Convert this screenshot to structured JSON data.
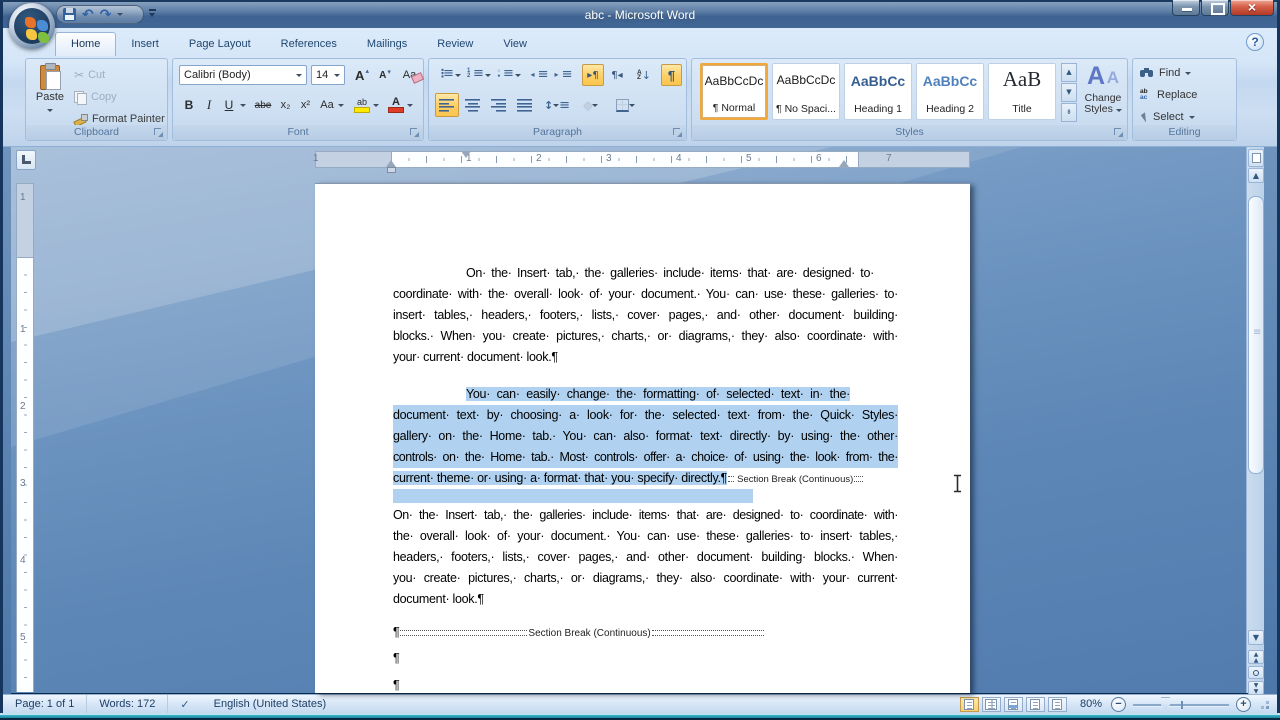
{
  "window": {
    "title": "abc  -  Microsoft Word"
  },
  "tabs": {
    "items": [
      "Home",
      "Insert",
      "Page Layout",
      "References",
      "Mailings",
      "Review",
      "View"
    ],
    "active": "Home"
  },
  "ribbon": {
    "clipboard": {
      "label": "Clipboard",
      "paste": "Paste",
      "cut": "Cut",
      "copy": "Copy",
      "format_painter": "Format Painter"
    },
    "font": {
      "label": "Font",
      "name": "Calibri (Body)",
      "size": "14"
    },
    "paragraph": {
      "label": "Paragraph"
    },
    "styles": {
      "label": "Styles",
      "change": "Change Styles",
      "items": [
        {
          "sample": "AaBbCcDc",
          "name": "¶ Normal"
        },
        {
          "sample": "AaBbCcDc",
          "name": "¶ No Spaci..."
        },
        {
          "sample": "AaBbCc",
          "name": "Heading 1"
        },
        {
          "sample": "AaBbCc",
          "name": "Heading 2"
        },
        {
          "sample": "AaB",
          "name": "Title"
        }
      ]
    },
    "editing": {
      "label": "Editing",
      "find": "Find",
      "replace": "Replace",
      "select": "Select"
    }
  },
  "ruler": {
    "h_margin": "1",
    "h": [
      "1",
      "2",
      "3",
      "4",
      "5",
      "6"
    ],
    "h_right": "7",
    "v_margin": "1",
    "v": [
      "1",
      "2",
      "3",
      "4",
      "5"
    ]
  },
  "doc": {
    "p1": {
      "l1": "On· the· Insert· tab,· the· galleries· include· items· that· are· designed· to·",
      "l2": "coordinate· with· the· overall· look· of· your· document.· You· can· use· these· galleries· to·",
      "l3": "insert· tables,· headers,· footers,· lists,· cover· pages,· and· other· document· building·",
      "l4": "blocks.· When· you· create· pictures,· charts,· or· diagrams,· they· also· coordinate· with·",
      "l5": "your· current· document· look.¶"
    },
    "p2": {
      "l1": "You· can· easily· change· the· formatting· of· selected· text· in· the·",
      "l2": "document· text· by· choosing· a· look· for· the· selected· text· from· the· Quick· Styles·",
      "l3": "gallery· on· the· Home· tab.· You· can· also· format· text· directly· by· using· the· other·",
      "l4": "controls· on· the· Home· tab.· Most· controls· offer· a· choice· of· using· the· look· from· the·",
      "l5": "current· theme· or· using· a· format· that· you· specify· directly.¶",
      "break_label": "Section Break (Continuous)"
    },
    "p3": {
      "l1": "On· the· Insert· tab,· the· galleries· include· items· that· are· designed· to· coordinate· with·",
      "l2": "the· overall· look· of· your· document.· You· can· use· these· galleries· to· insert· tables,·",
      "l3": "headers,· footers,· lists,· cover· pages,· and· other· document· building· blocks.· When·",
      "l4": "you· create· pictures,· charts,· or· diagrams,· they· also· coordinate· with· your· current·",
      "l5": "document· look.¶"
    },
    "sb": {
      "pilcrow": "¶",
      "label": "Section Break (Continuous)"
    },
    "pm1": "¶",
    "pm2": "¶"
  },
  "status": {
    "page": "Page: 1 of 1",
    "words": "Words: 172",
    "lang": "English (United States)",
    "zoom": "80%"
  },
  "colors": {
    "selection": "#b0d2f0",
    "toggle_highlight": "#fcd069",
    "close_button": "#c8493a",
    "title_bar": "#3e6392"
  }
}
